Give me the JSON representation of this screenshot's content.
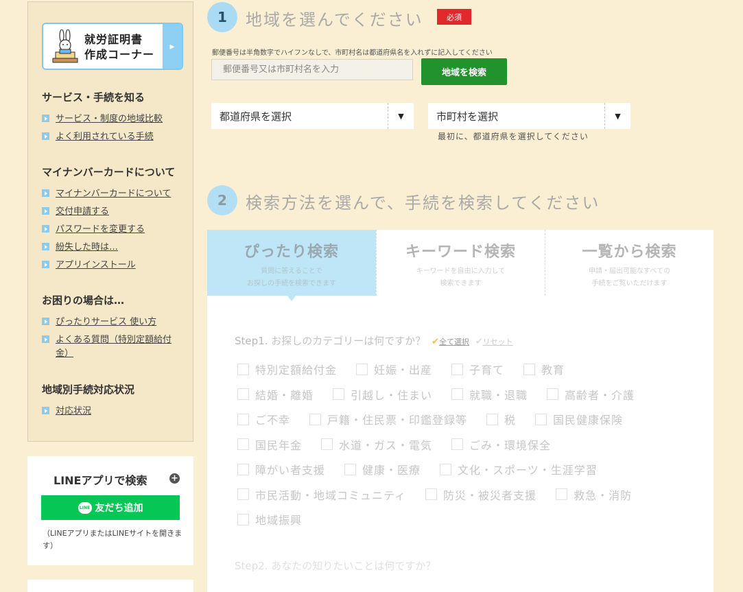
{
  "sidebar": {
    "banner_line1": "就労証明書",
    "banner_line2": "作成コーナー",
    "banner_arrow": "▸",
    "sections": [
      {
        "title": "サービス・手続を知る",
        "links": [
          "サービス・制度の地域比較",
          "よく利用されている手続"
        ]
      },
      {
        "title": "マイナンバーカードについて",
        "links": [
          "マイナンバーカードについて",
          "交付申請する",
          "パスワードを変更する",
          "紛失した時は…",
          "アプリインストール"
        ]
      },
      {
        "title": "お困りの場合は…",
        "links": [
          "ぴったりサービス 使い方",
          "よくある質問（特別定額給付金）"
        ]
      },
      {
        "title": "地域別手続対応状況",
        "links": [
          "対応状況"
        ]
      }
    ]
  },
  "line": {
    "title": "LINEアプリで検索",
    "plus": "+",
    "button_icon": "LINE",
    "button": "友だち追加",
    "note": "（LINEアプリまたはLINEサイトを開きます）"
  },
  "step1": {
    "number": "1",
    "heading": "地域を選んでください",
    "required": "必須",
    "hint": "郵便番号は半角数字でハイフンなしで、市町村名は都道府県名を入れずに記入してください",
    "input_placeholder": "郵便番号又は市町村名を入力",
    "search_button": "地域を検索",
    "pref_select": "都道府県を選択",
    "city_select": "市町村を選択",
    "select_arrow": "▼",
    "city_note": "最初に、都道府県を選択してください"
  },
  "step2": {
    "number": "2",
    "heading": "検索方法を選んで、手続を検索してください",
    "tabs": [
      {
        "name": "ぴったり検索",
        "desc1": "質問に答えることで",
        "desc2": "お探しの手続を検索できます"
      },
      {
        "name": "キーワード検索",
        "desc1": "キーワードを自由に入力して",
        "desc2": "検索できます"
      },
      {
        "name": "一覧から検索",
        "desc1": "申請・届出可能なすべての",
        "desc2": "手続をご覧いただけます"
      }
    ],
    "q1_label": "Step1.",
    "q1_text": "お探しのカテゴリーは何ですか？",
    "select_all": "全て選択",
    "reset": "リセット",
    "check_mark": "✔",
    "categories": [
      [
        "特別定額給付金",
        "妊娠・出産",
        "子育て",
        "教育"
      ],
      [
        "結婚・離婚",
        "引越し・住まい",
        "就職・退職",
        "高齢者・介護"
      ],
      [
        "ご不幸",
        "戸籍・住民票・印鑑登録等",
        "税",
        "国民健康保険"
      ],
      [
        "国民年金",
        "水道・ガス・電気",
        "ごみ・環境保全"
      ],
      [
        "障がい者支援",
        "健康・医療",
        "文化・スポーツ・生涯学習"
      ],
      [
        "市民活動・地域コミュニティ",
        "防災・被災者支援",
        "救急・消防"
      ],
      [
        "地域振興"
      ]
    ],
    "q2_label": "Step2.",
    "q2_text": "あなたの知りたいことは何ですか？"
  }
}
